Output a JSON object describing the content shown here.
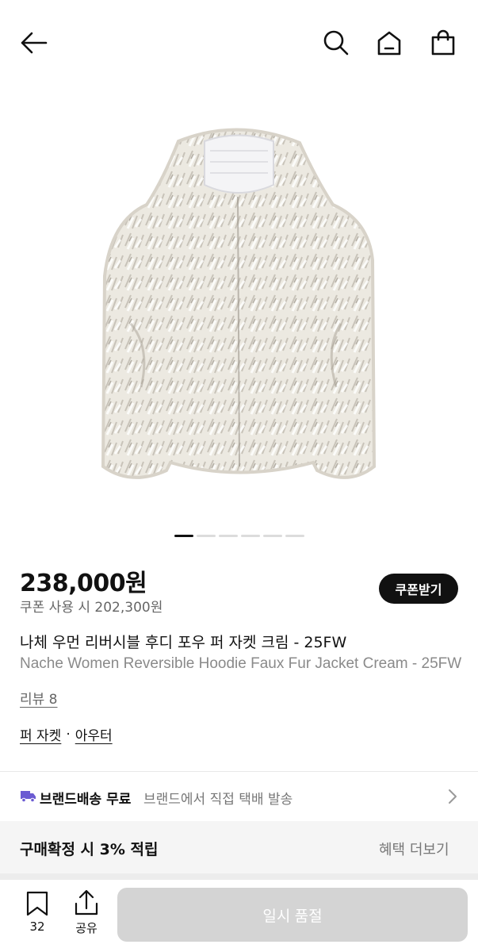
{
  "header": {
    "icons": [
      "arrow-left-icon",
      "search-icon",
      "home-icon",
      "shopping-bag-icon"
    ]
  },
  "gallery": {
    "image_subject": "fur-hoodie-jacket",
    "page_count": 6,
    "current_index": 1
  },
  "product": {
    "price": "238,000원",
    "coupon_price": "쿠폰 사용 시 202,300원",
    "coupon_button": "쿠폰받기",
    "title_ko": "나체 우먼 리버시블 후디 포우 퍼 자켓 크림 - 25FW",
    "title_en": "Nache Women Reversible Hoodie Faux Fur Jacket Cream - 25FW",
    "review_link": "리뷰 8",
    "categories": [
      "퍼 자켓",
      "아우터"
    ],
    "category_separator": "·"
  },
  "shipping": {
    "icon": "truck-icon",
    "label": "브랜드배송 무료",
    "description": "브랜드에서 직접 택배 발송"
  },
  "benefit": {
    "label": "구매확정 시 3% 적립",
    "more": "혜택 더보기"
  },
  "bottom_bar": {
    "bookmark_count": "32",
    "share_label": "공유",
    "cta_label": "일시 품절"
  },
  "colors": {
    "primary": "#111111",
    "muted": "#777777",
    "disabled_button": "#d4d4d4",
    "truck": "#6b5bd2"
  }
}
